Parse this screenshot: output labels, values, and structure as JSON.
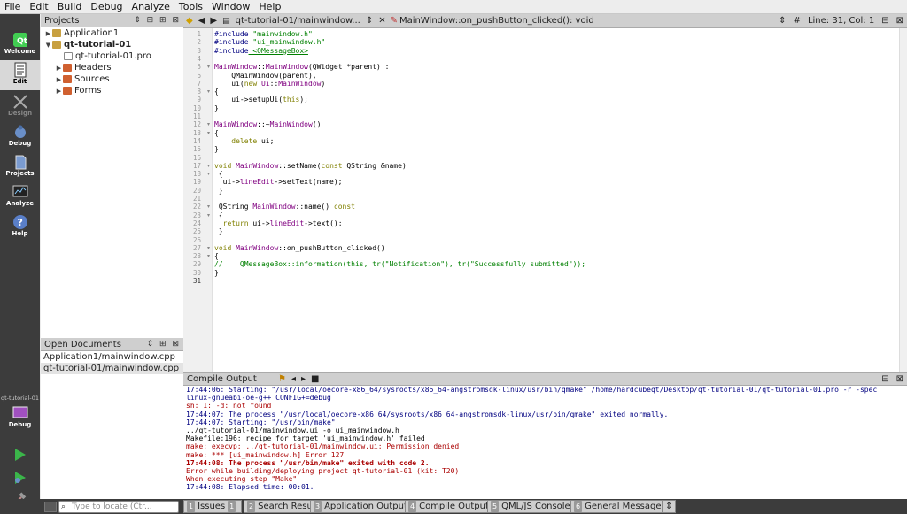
{
  "menu": [
    "File",
    "Edit",
    "Build",
    "Debug",
    "Analyze",
    "Tools",
    "Window",
    "Help"
  ],
  "modes": [
    "Welcome",
    "Edit",
    "Design",
    "Debug",
    "Projects",
    "Analyze",
    "Help"
  ],
  "target": {
    "project": "qt-tutorial-01",
    "config": "Debug"
  },
  "projects": {
    "title": "Projects",
    "tree": [
      {
        "label": "Application1",
        "level": 0,
        "expanded": false
      },
      {
        "label": "qt-tutorial-01",
        "level": 0,
        "expanded": true,
        "bold": true
      },
      {
        "label": "qt-tutorial-01.pro",
        "level": 1
      },
      {
        "label": "Headers",
        "level": 1,
        "expanded": false
      },
      {
        "label": "Sources",
        "level": 1,
        "expanded": false
      },
      {
        "label": "Forms",
        "level": 1,
        "expanded": false
      }
    ]
  },
  "open_documents": {
    "title": "Open Documents",
    "items": [
      "Application1/mainwindow.cpp",
      "qt-tutorial-01/mainwindow.cpp"
    ]
  },
  "editor": {
    "file_tab": "qt-tutorial-01/mainwindow...",
    "symbol": "MainWindow::on_pushButton_clicked(): void",
    "position": "Line: 31, Col: 1",
    "hash": "#",
    "current_line": 31,
    "lines": [
      "#include \"mainwindow.h\"",
      "#include \"ui_mainwindow.h\"",
      "#include <QMessageBox>",
      "",
      "MainWindow::MainWindow(QWidget *parent) :",
      "    QMainWindow(parent),",
      "    ui(new Ui::MainWindow)",
      "{",
      "    ui->setupUi(this);",
      "}",
      "",
      "MainWindow::~MainWindow()",
      "{",
      "    delete ui;",
      "}",
      "",
      "void MainWindow::setName(const QString &name)",
      " {",
      "  ui->lineEdit->setText(name);",
      " }",
      "",
      " QString MainWindow::name() const",
      " {",
      "  return ui->lineEdit->text();",
      " }",
      "",
      "void MainWindow::on_pushButton_clicked()",
      "{",
      "//    QMessageBox::information(this, tr(\"Notification\"), tr(\"Successfully submitted\"));",
      "}",
      ""
    ]
  },
  "compile_output": {
    "title": "Compile Output",
    "lines": [
      {
        "text": "17:44:06: Starting: \"/usr/local/oecore-x86_64/sysroots/x86_64-angstromsdk-linux/usr/bin/qmake\" /home/hardcubeqt/Desktop/qt-tutorial-01/qt-tutorial-01.pro -r -spec",
        "kind": "info"
      },
      {
        "text": "linux-gnueabi-oe-g++ CONFIG+=debug",
        "kind": "info"
      },
      {
        "text": "sh: 1: -d: not found",
        "kind": "error"
      },
      {
        "text": "17:44:07: The process \"/usr/local/oecore-x86_64/sysroots/x86_64-angstromsdk-linux/usr/bin/qmake\" exited normally.",
        "kind": "info"
      },
      {
        "text": "17:44:07: Starting: \"/usr/bin/make\"",
        "kind": "info"
      },
      {
        "text": "../qt-tutorial-01/mainwindow.ui -o ui_mainwindow.h",
        "kind": "plain"
      },
      {
        "text": "Makefile:196: recipe for target 'ui_mainwindow.h' failed",
        "kind": "plain"
      },
      {
        "text": "make: execvp: ../qt-tutorial-01/mainwindow.ui: Permission denied",
        "kind": "error"
      },
      {
        "text": "make: *** [ui_mainwindow.h] Error 127",
        "kind": "error"
      },
      {
        "text": "17:44:08: The process \"/usr/bin/make\" exited with code 2.",
        "kind": "errorbold"
      },
      {
        "text": "Error while building/deploying project qt-tutorial-01 (kit: T20)",
        "kind": "error"
      },
      {
        "text": "When executing step \"Make\"",
        "kind": "error"
      },
      {
        "text": "17:44:08: Elapsed time: 00:01.",
        "kind": "info"
      }
    ]
  },
  "locator_placeholder": "Type to locate (Ctr...",
  "output_panes": [
    {
      "num": "1",
      "label": "Issues",
      "badge": "1"
    },
    {
      "num": "2",
      "label": "Search Results"
    },
    {
      "num": "3",
      "label": "Application Output"
    },
    {
      "num": "4",
      "label": "Compile Output"
    },
    {
      "num": "5",
      "label": "QML/JS Console"
    },
    {
      "num": "6",
      "label": "General Messages"
    }
  ],
  "colors": {
    "keyword": "#808000",
    "type": "#800080",
    "string": "#008000",
    "comment": "#008000",
    "include": "#000080",
    "error": "#aa0000",
    "info": "#000080"
  }
}
